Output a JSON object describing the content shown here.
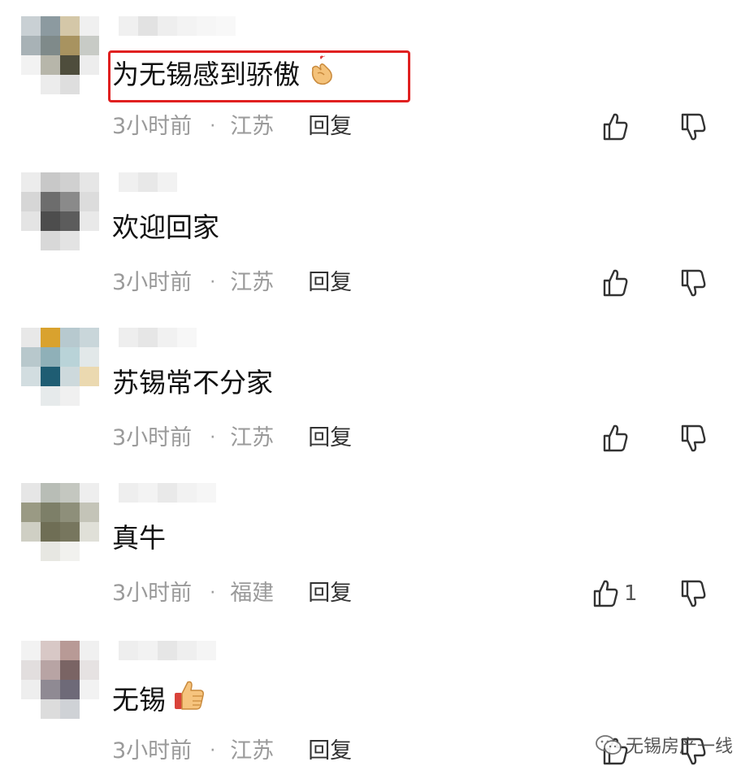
{
  "comments": [
    {
      "text": "为无锡感到骄傲",
      "time": "3小时前",
      "location": "江苏",
      "reply": "回复",
      "likes": ""
    },
    {
      "text": "欢迎回家",
      "time": "3小时前",
      "location": "江苏",
      "reply": "回复",
      "likes": ""
    },
    {
      "text": "苏锡常不分家",
      "time": "3小时前",
      "location": "江苏",
      "reply": "回复",
      "likes": ""
    },
    {
      "text": "真牛",
      "time": "3小时前",
      "location": "福建",
      "reply": "回复",
      "likes": "1"
    },
    {
      "text": "无锡",
      "time": "3小时前",
      "location": "江苏",
      "reply": "回复",
      "likes": ""
    }
  ],
  "separator": "·",
  "watermark": "无锡房产一线",
  "icons": {
    "like": "thumbs-up-icon",
    "dislike": "thumbs-down-icon",
    "emoji_1": "finger-heart-emoji",
    "emoji_5": "thumbs-up-emoji"
  },
  "colors": {
    "highlight_border": "#e02020",
    "text": "#111111",
    "meta": "#9a9a9a",
    "reply": "#333333"
  }
}
